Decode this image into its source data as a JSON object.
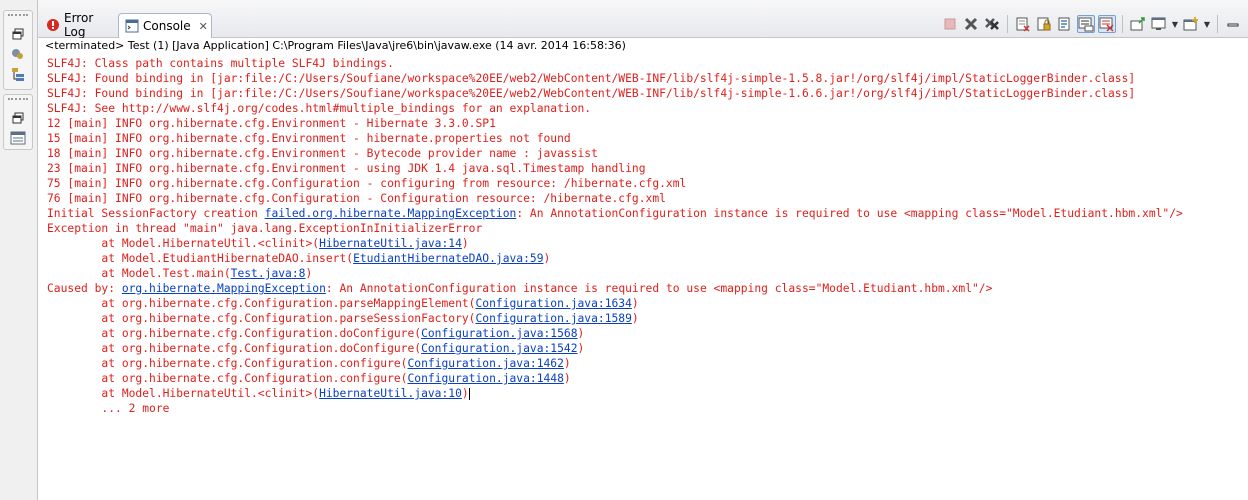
{
  "tabs": [
    {
      "label": "Error Log",
      "active": false
    },
    {
      "label": "Console",
      "active": true
    }
  ],
  "toolbar": {
    "icons": [
      "terminate-icon",
      "remove-launch-icon",
      "remove-all-terminated-icon",
      "clear-console-icon",
      "scroll-lock-icon",
      "word-wrap-icon",
      "show-console-on-stdout-icon",
      "show-console-on-stderr-icon",
      "pin-console-icon",
      "display-selected-console-icon",
      "open-console-icon",
      "view-menu-icon"
    ]
  },
  "console": {
    "description": "<terminated> Test (1) [Java Application] C:\\Program Files\\Java\\jre6\\bin\\javaw.exe (14 avr. 2014 16:58:36)",
    "lines": [
      [
        {
          "t": "SLF4J: Class path contains multiple SLF4J bindings."
        }
      ],
      [
        {
          "t": "SLF4J: Found binding in [jar:file:/C:/Users/Soufiane/workspace%20EE/web2/WebContent/WEB-INF/lib/slf4j-simple-1.5.8.jar!/org/slf4j/impl/StaticLoggerBinder.class]"
        }
      ],
      [
        {
          "t": "SLF4J: Found binding in [jar:file:/C:/Users/Soufiane/workspace%20EE/web2/WebContent/WEB-INF/lib/slf4j-simple-1.6.6.jar!/org/slf4j/impl/StaticLoggerBinder.class]"
        }
      ],
      [
        {
          "t": "SLF4J: See http://www.slf4j.org/codes.html#multiple_bindings for an explanation."
        }
      ],
      [
        {
          "t": "12 [main] INFO org.hibernate.cfg.Environment - Hibernate 3.3.0.SP1"
        }
      ],
      [
        {
          "t": "15 [main] INFO org.hibernate.cfg.Environment - hibernate.properties not found"
        }
      ],
      [
        {
          "t": "18 [main] INFO org.hibernate.cfg.Environment - Bytecode provider name : javassist"
        }
      ],
      [
        {
          "t": "23 [main] INFO org.hibernate.cfg.Environment - using JDK 1.4 java.sql.Timestamp handling"
        }
      ],
      [
        {
          "t": "75 [main] INFO org.hibernate.cfg.Configuration - configuring from resource: /hibernate.cfg.xml"
        }
      ],
      [
        {
          "t": "76 [main] INFO org.hibernate.cfg.Configuration - Configuration resource: /hibernate.cfg.xml"
        }
      ],
      [
        {
          "t": "Initial SessionFactory creation "
        },
        {
          "t": "failed.org.hibernate.MappingException",
          "link": true
        },
        {
          "t": ": An AnnotationConfiguration instance is required to use <mapping class=\"Model.Etudiant.hbm.xml\"/>"
        }
      ],
      [
        {
          "t": "Exception in thread \"main\" java.lang.ExceptionInInitializerError"
        }
      ],
      [
        {
          "t": "\tat Model.HibernateUtil.<clinit>("
        },
        {
          "t": "HibernateUtil.java:14",
          "link": true
        },
        {
          "t": ")"
        }
      ],
      [
        {
          "t": "\tat Model.EtudiantHibernateDAO.insert("
        },
        {
          "t": "EtudiantHibernateDAO.java:59",
          "link": true
        },
        {
          "t": ")"
        }
      ],
      [
        {
          "t": "\tat Model.Test.main("
        },
        {
          "t": "Test.java:8",
          "link": true
        },
        {
          "t": ")"
        }
      ],
      [
        {
          "t": "Caused by: "
        },
        {
          "t": "org.hibernate.MappingException",
          "link": true
        },
        {
          "t": ": An AnnotationConfiguration instance is required to use <mapping class=\"Model.Etudiant.hbm.xml\"/>"
        }
      ],
      [
        {
          "t": "\tat org.hibernate.cfg.Configuration.parseMappingElement("
        },
        {
          "t": "Configuration.java:1634",
          "link": true
        },
        {
          "t": ")"
        }
      ],
      [
        {
          "t": "\tat org.hibernate.cfg.Configuration.parseSessionFactory("
        },
        {
          "t": "Configuration.java:1589",
          "link": true
        },
        {
          "t": ")"
        }
      ],
      [
        {
          "t": "\tat org.hibernate.cfg.Configuration.doConfigure("
        },
        {
          "t": "Configuration.java:1568",
          "link": true
        },
        {
          "t": ")"
        }
      ],
      [
        {
          "t": "\tat org.hibernate.cfg.Configuration.doConfigure("
        },
        {
          "t": "Configuration.java:1542",
          "link": true
        },
        {
          "t": ")"
        }
      ],
      [
        {
          "t": "\tat org.hibernate.cfg.Configuration.configure("
        },
        {
          "t": "Configuration.java:1462",
          "link": true
        },
        {
          "t": ")"
        }
      ],
      [
        {
          "t": "\tat org.hibernate.cfg.Configuration.configure("
        },
        {
          "t": "Configuration.java:1448",
          "link": true
        },
        {
          "t": ")"
        }
      ],
      [
        {
          "t": "\tat Model.HibernateUtil.<clinit>("
        },
        {
          "t": "HibernateUtil.java:10",
          "link": true
        },
        {
          "t": ")"
        }
      ],
      [
        {
          "t": "\t... 2 more"
        }
      ]
    ]
  }
}
